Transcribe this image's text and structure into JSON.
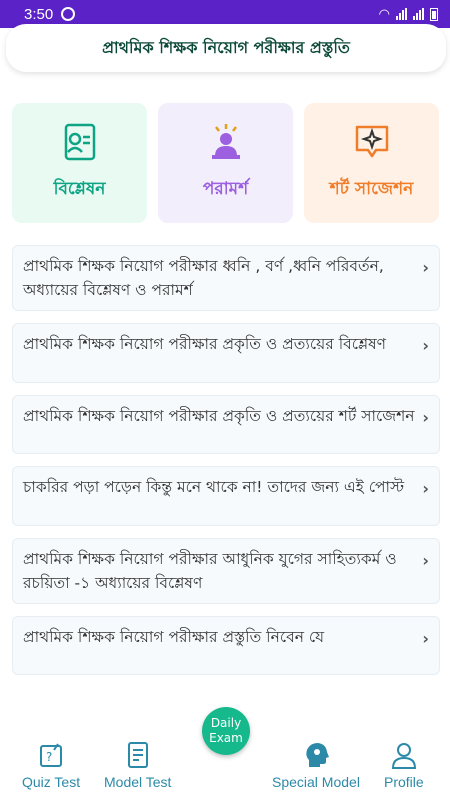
{
  "status": {
    "time": "3:50"
  },
  "header": {
    "title": "প্রাথমিক শিক্ষক নিয়োগ পরীক্ষার প্রস্তুতি"
  },
  "cards": [
    {
      "label": "বিশ্লেষন",
      "icon": "analysis-icon"
    },
    {
      "label": "পরামর্শ",
      "icon": "advice-icon"
    },
    {
      "label": "শর্ট সাজেশন",
      "icon": "suggestion-icon"
    }
  ],
  "list": [
    {
      "text": "প্রাথমিক শিক্ষক নিয়োগ পরীক্ষার ধ্বনি , বর্ণ ,ধ্বনি পরিবর্তন, অধ্যায়ের বিশ্লেষণ ও পরামর্শ"
    },
    {
      "text": "প্রাথমিক শিক্ষক নিয়োগ পরীক্ষার প্রকৃতি ও প্রত্যয়ের বিশ্লেষণ"
    },
    {
      "text": "প্রাথমিক শিক্ষক নিয়োগ পরীক্ষার প্রকৃতি ও প্রত্যয়ের শর্ট সাজেশন"
    },
    {
      "text": "চাকরির পড়া পড়েন কিন্তু মনে থাকে না! তাদের জন্য এই পোস্ট"
    },
    {
      "text": "প্রাথমিক শিক্ষক নিয়োগ পরীক্ষার আধুনিক যুগের সাহিত্যকর্ম ও রচয়িতা -১ অধ্যায়ের বিশ্লেষণ"
    },
    {
      "text": "প্রাথমিক শিক্ষক নিয়োগ পরীক্ষার প্রস্তুতি নিবেন যে"
    }
  ],
  "bottom_nav": {
    "quiz": "Quiz Test",
    "model": "Model Test",
    "daily_line1": "Daily",
    "daily_line2": "Exam",
    "special": "Special Model",
    "profile": "Profile"
  },
  "colors": {
    "status_bar": "#5b22c8",
    "accent": "#16b98b",
    "nav_text": "#2c8aa8"
  }
}
